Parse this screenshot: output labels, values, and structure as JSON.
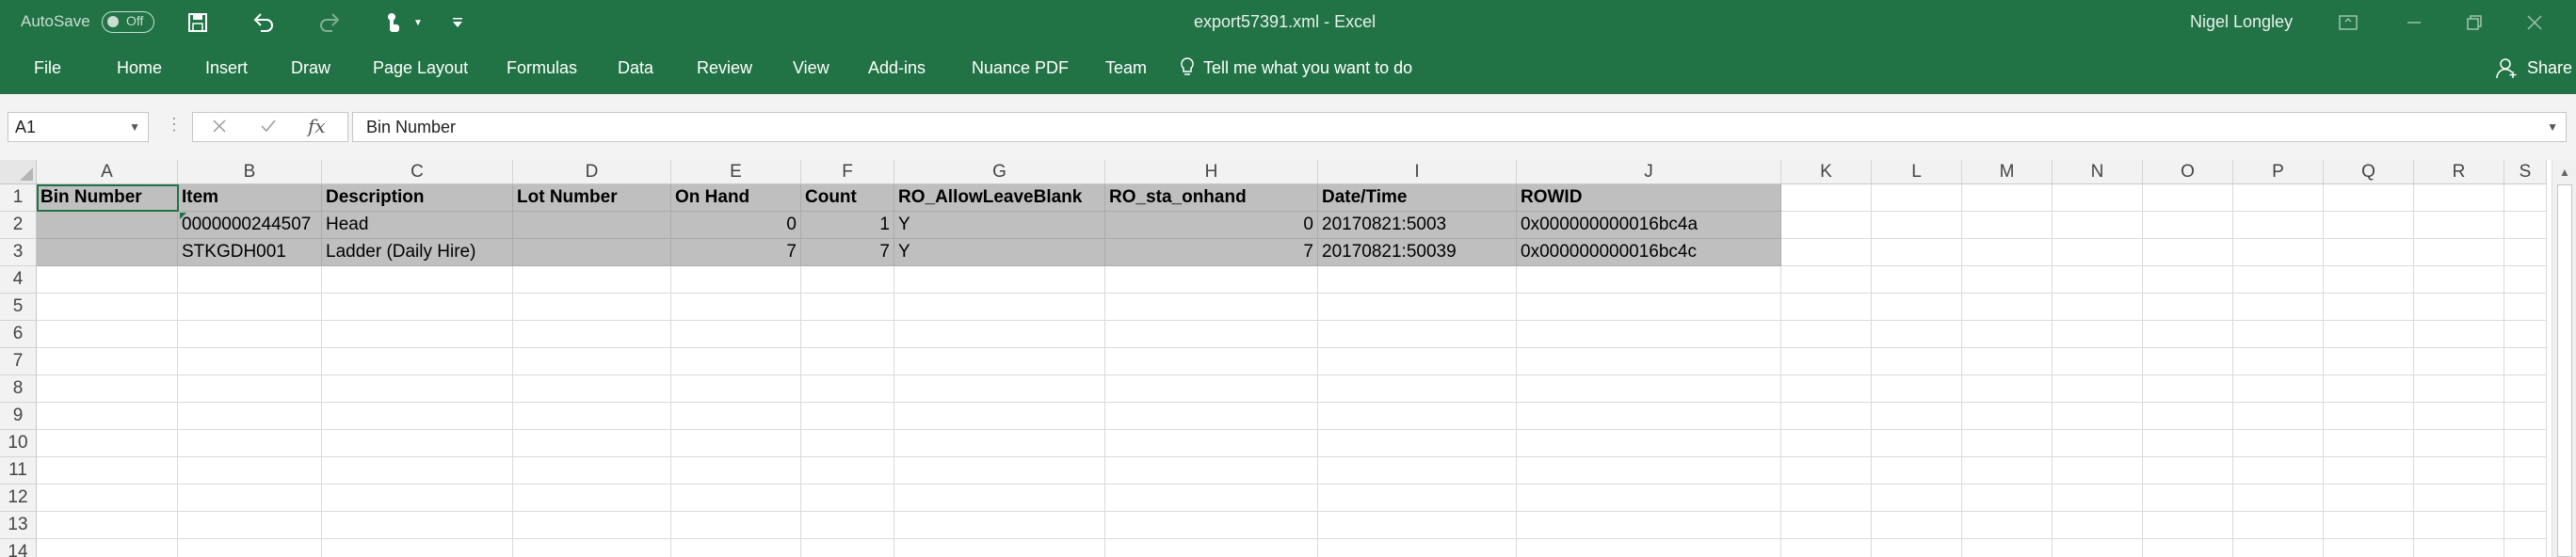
{
  "titlebar": {
    "autosave_label": "AutoSave",
    "autosave_state": "Off",
    "window_title": "export57391.xml  -  Excel",
    "user_name": "Nigel Longley"
  },
  "ribbon": {
    "tabs": [
      "File",
      "Home",
      "Insert",
      "Draw",
      "Page Layout",
      "Formulas",
      "Data",
      "Review",
      "View",
      "Add-ins",
      "Nuance PDF",
      "Team"
    ],
    "tell_me": "Tell me what you want to do",
    "share": "Share"
  },
  "formula_bar": {
    "name_box": "A1",
    "fx": "fx",
    "formula": "Bin Number"
  },
  "sheet": {
    "columns": [
      "A",
      "B",
      "C",
      "D",
      "E",
      "F",
      "G",
      "H",
      "I",
      "J",
      "K",
      "L",
      "M",
      "N",
      "O",
      "P",
      "Q",
      "R",
      "S"
    ],
    "rows": [
      "1",
      "2",
      "3",
      "4",
      "5",
      "6",
      "7",
      "8",
      "9",
      "10",
      "11",
      "12",
      "13",
      "14"
    ],
    "header": [
      "Bin Number",
      "Item",
      "Description",
      "Lot Number",
      "On Hand",
      "Count",
      "RO_AllowLeaveBlank",
      "RO_sta_onhand",
      "Date/Time",
      "ROWID"
    ],
    "data": [
      [
        "",
        "0000000244507",
        "Head",
        "",
        "0",
        "1",
        "Y",
        "0",
        "20170821:5003",
        "0x000000000016bc4a"
      ],
      [
        "",
        "STKGDH001",
        "Ladder (Daily Hire)",
        "",
        "7",
        "7",
        "Y",
        "7",
        "20170821:50039",
        "0x000000000016bc4c"
      ]
    ]
  },
  "icons": {
    "save": "save-icon",
    "undo": "undo-icon",
    "redo": "redo-icon",
    "touch": "touch-mode-icon",
    "customize": "customize-qat-icon",
    "lightbulb": "lightbulb-icon",
    "share": "person-share-icon",
    "ribbon_display": "ribbon-display-icon",
    "minimize": "minimize-icon",
    "restore": "restore-icon",
    "close": "close-icon"
  },
  "colors": {
    "excel_green": "#217346",
    "selected_header_fill": "#bfbfbf"
  }
}
